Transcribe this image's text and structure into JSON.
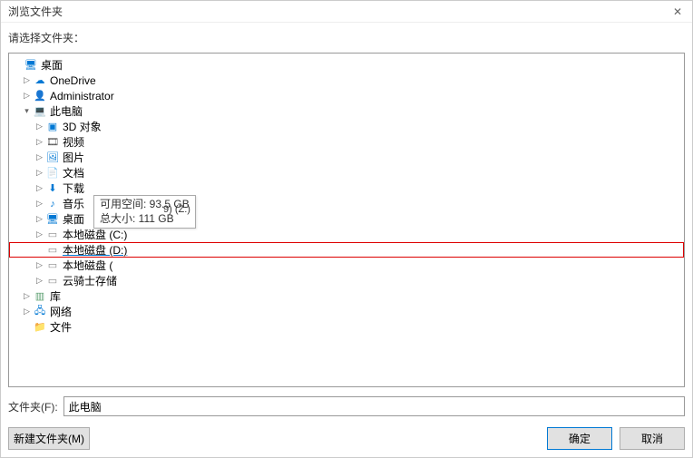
{
  "title": "浏览文件夹",
  "prompt": "请选择文件夹：",
  "tree": {
    "desktop": "桌面",
    "onedrive": "OneDrive",
    "admin": "Administrator",
    "thispc": "此电脑",
    "obj3d": "3D 对象",
    "video": "视频",
    "pictures": "图片",
    "documents": "文档",
    "downloads": "下载",
    "music": "音乐",
    "desk2": "桌面",
    "diskC": "本地磁盘 (C:)",
    "diskD": "本地磁盘 (D:)",
    "diskE": "本地磁盘 (",
    "cloudZ": "云骑士存储",
    "zTrail": "9) (Z:)",
    "libs": "库",
    "network": "网络",
    "files": "文件"
  },
  "tooltip": {
    "line1": "可用空间: 93.5 GB",
    "line2": "总大小: 111 GB"
  },
  "folderLabel": "文件夹(F):",
  "folderValue": "此电脑",
  "buttons": {
    "newFolder": "新建文件夹(M)",
    "ok": "确定",
    "cancel": "取消"
  }
}
